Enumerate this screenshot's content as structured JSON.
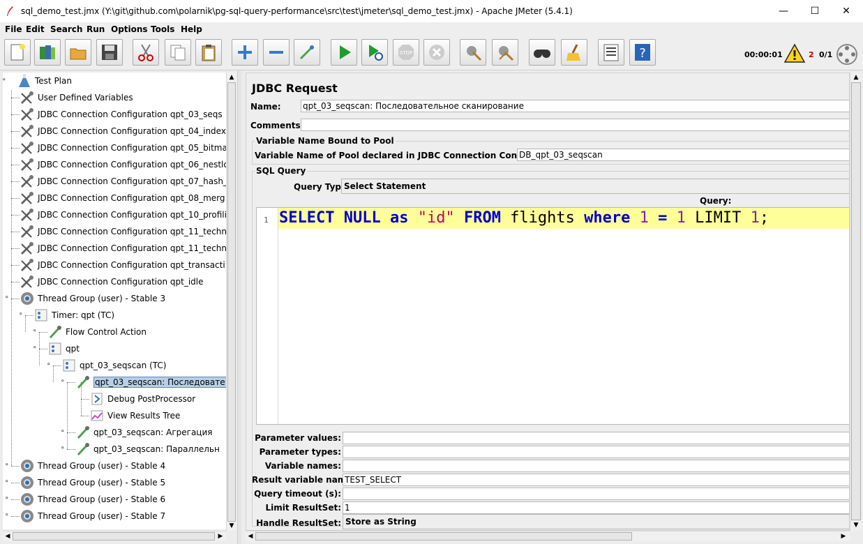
{
  "window": {
    "title": "sql_demo_test.jmx (Y:\\git\\github.com\\polarnik\\pg-sql-query-performance\\src\\test\\jmeter\\sql_demo_test.jmx) - Apache JMeter (5.4.1)",
    "minimize": "—",
    "maximize": "☐",
    "close": "✕"
  },
  "menu": [
    "File",
    "Edit",
    "Search",
    "Run",
    "Options",
    "Tools",
    "Help"
  ],
  "toolbar": {
    "buttons": [
      "new-icon",
      "templates-icon",
      "open-icon",
      "save-icon",
      "cut-icon",
      "copy-icon",
      "paste-icon",
      "expand-icon",
      "collapse-icon",
      "toggle-icon",
      "start-icon",
      "start-no-timers-icon",
      "stop-icon",
      "shutdown-icon",
      "clear-icon",
      "clear-all-icon",
      "search-icon",
      "reset-search-icon",
      "function-helper-icon",
      "help-icon"
    ],
    "elapsed": "00:00:01",
    "warnings": "2",
    "threads": "0/1"
  },
  "tree": {
    "items": [
      {
        "label": "Test Plan",
        "icon": "test-plan-icon"
      },
      {
        "label": "User Defined Variables",
        "icon": "wrench-icon"
      },
      {
        "label": "JDBC Connection Configuration qpt_03_seqs",
        "icon": "wrench-icon"
      },
      {
        "label": "JDBC Connection Configuration qpt_04_index",
        "icon": "wrench-icon"
      },
      {
        "label": "JDBC Connection Configuration qpt_05_bitma",
        "icon": "wrench-icon"
      },
      {
        "label": "JDBC Connection Configuration qpt_06_nestlo",
        "icon": "wrench-icon"
      },
      {
        "label": "JDBC Connection Configuration qpt_07_hash_",
        "icon": "wrench-icon"
      },
      {
        "label": "JDBC Connection Configuration qpt_08_merg",
        "icon": "wrench-icon"
      },
      {
        "label": "JDBC Connection Configuration qpt_10_profili",
        "icon": "wrench-icon"
      },
      {
        "label": "JDBC Connection Configuration qpt_11_techn",
        "icon": "wrench-icon"
      },
      {
        "label": "JDBC Connection Configuration qpt_11_techn",
        "icon": "wrench-icon"
      },
      {
        "label": "JDBC Connection Configuration qpt_transacti",
        "icon": "wrench-icon"
      },
      {
        "label": "JDBC Connection Configuration qpt_idle",
        "icon": "wrench-icon"
      },
      {
        "label": "Thread Group (user) - Stable 3",
        "icon": "gear-icon"
      },
      {
        "label": "Timer: qpt (TC)",
        "icon": "controller-icon"
      },
      {
        "label": "Flow Control Action",
        "icon": "sampler-icon"
      },
      {
        "label": "qpt",
        "icon": "controller-icon"
      },
      {
        "label": "qpt_03_seqscan (TC)",
        "icon": "controller-icon"
      },
      {
        "label": "qpt_03_seqscan: Последовате",
        "icon": "sampler-icon"
      },
      {
        "label": "Debug PostProcessor",
        "icon": "postprocessor-icon"
      },
      {
        "label": "View Results Tree",
        "icon": "listener-icon"
      },
      {
        "label": "qpt_03_seqscan: Агрегация",
        "icon": "sampler-icon"
      },
      {
        "label": "qpt_03_seqscan: Параллельн",
        "icon": "sampler-icon"
      },
      {
        "label": "Thread Group (user) - Stable 4",
        "icon": "gear-icon"
      },
      {
        "label": "Thread Group (user) - Stable 5",
        "icon": "gear-icon"
      },
      {
        "label": "Thread Group (user) - Stable 6",
        "icon": "gear-icon"
      },
      {
        "label": "Thread Group (user) - Stable 7",
        "icon": "gear-icon"
      }
    ]
  },
  "jdbc": {
    "heading": "JDBC Request",
    "name_label": "Name:",
    "name_value": "qpt_03_seqscan: Последовательное сканирование",
    "comments_label": "Comments:",
    "comments_value": "",
    "pool_group": "Variable Name Bound to Pool",
    "pool_label": "Variable Name of Pool declared in JDBC Connection Configuration:",
    "pool_value": "DB_qpt_03_seqscan",
    "sql_group": "SQL Query",
    "query_type_label": "Query Type:",
    "query_type_value": "Select Statement",
    "query_label": "Query:",
    "line_number": "1",
    "query_tokens": [
      {
        "t": "SELECT",
        "c": "kw"
      },
      {
        "t": " ",
        "c": "plain"
      },
      {
        "t": "NULL",
        "c": "kw"
      },
      {
        "t": " ",
        "c": "plain"
      },
      {
        "t": "as",
        "c": "kw"
      },
      {
        "t": " ",
        "c": "plain"
      },
      {
        "t": "\"id\"",
        "c": "str"
      },
      {
        "t": " ",
        "c": "plain"
      },
      {
        "t": "FROM",
        "c": "kw"
      },
      {
        "t": " flights ",
        "c": "plain"
      },
      {
        "t": "where",
        "c": "kw"
      },
      {
        "t": " ",
        "c": "plain"
      },
      {
        "t": "1",
        "c": "num"
      },
      {
        "t": " = ",
        "c": "kw"
      },
      {
        "t": "1",
        "c": "num"
      },
      {
        "t": " LIMIT ",
        "c": "plain"
      },
      {
        "t": "1",
        "c": "num"
      },
      {
        "t": ";",
        "c": "plain"
      }
    ],
    "params": [
      {
        "label": "Parameter values:",
        "value": ""
      },
      {
        "label": "Parameter types:",
        "value": ""
      },
      {
        "label": "Variable names:",
        "value": ""
      },
      {
        "label": "Result variable name:",
        "value": "TEST_SELECT"
      },
      {
        "label": "Query timeout (s):",
        "value": ""
      },
      {
        "label": "Limit ResultSet:",
        "value": "1"
      }
    ],
    "handle_label": "Handle ResultSet:",
    "handle_value": "Store as String"
  }
}
